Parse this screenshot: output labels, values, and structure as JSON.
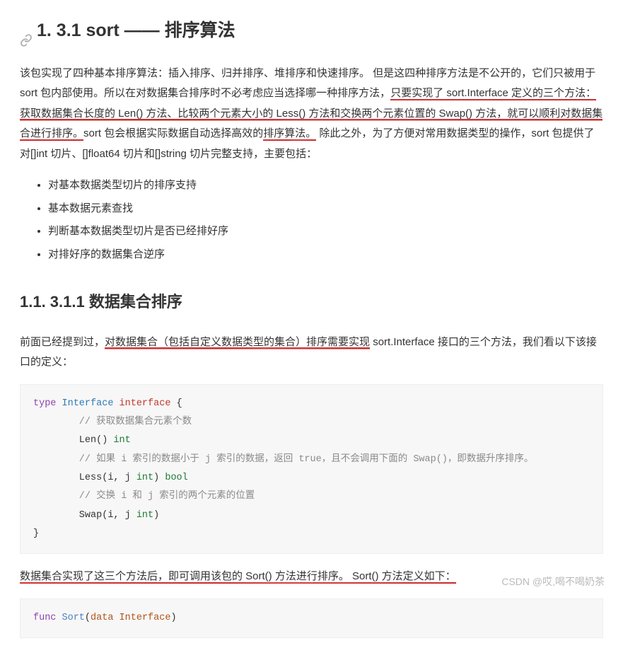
{
  "heading1": "1. 3.1 sort —— 排序算法",
  "intro": {
    "seg1": "该包实现了四种基本排序算法：插入排序、归并排序、堆排序和快速排序。 但是这四种排序方法是不公开的，它们只被用于 sort 包内部使用。所以在对数据集合排序时不必考虑应当选择哪一种排序方法，",
    "ul1": "只要实现了 sort.Interface 定义的三个方法：获取数据集合长度的 Len() 方法、比较两个元素大小的 Less() 方法和交换两个元素位置的 Swap() 方法，就可以顺利对数据集合进行排序。",
    "seg2": "sort 包会根据实际数据自动选择高效的",
    "ul2": "排序算法。",
    "seg3": " 除此之外，为了方便对常用数据类型的操作，sort 包提供了对[]int 切片、[]float64 切片和[]string 切片完整支持，主要包括："
  },
  "bullets": [
    "对基本数据类型切片的排序支持",
    "基本数据元素查找",
    "判断基本数据类型切片是否已经排好序",
    "对排好序的数据集合逆序"
  ],
  "heading2": "1.1. 3.1.1 数据集合排序",
  "para2": {
    "seg1": "前面已经提到过，",
    "ul1": "对数据集合（包括自定义数据类型的集合）排序需要实现",
    "seg2": " sort.Interface 接口的三个方法，我们看以下该接口的定义："
  },
  "code1": {
    "l1_type": "type",
    "l1_name": " Interface ",
    "l1_iface": "interface",
    "l1_brace": " {",
    "l2_comm": "        // 获取数据集合元素个数",
    "l3_len": "        Len() ",
    "l3_int": "int",
    "l4_comm": "        // 如果 i 索引的数据小于 j 索引的数据，返回 true，且不会调用下面的 Swap()，即数据升序排序。",
    "l5_less": "        Less(i, j ",
    "l5_int": "int",
    "l5_b": ") ",
    "l5_bool": "bool",
    "l6_comm": "        // 交换 i 和 j 索引的两个元素的位置",
    "l7_swap": "        Swap(i, j ",
    "l7_int": "int",
    "l7_b": ")",
    "l8_brace": "}"
  },
  "para3": {
    "ul1": "数据集合实现了这三个方法后，即可调用该包的 Sort() 方法进行排序。 Sort() 方法定义如下："
  },
  "code2": {
    "func": "func",
    "sort": " Sort",
    "paren_o": "(",
    "arg": "data Interface",
    "paren_c": ")"
  },
  "watermark": "CSDN @哎,喝不喝奶茶"
}
